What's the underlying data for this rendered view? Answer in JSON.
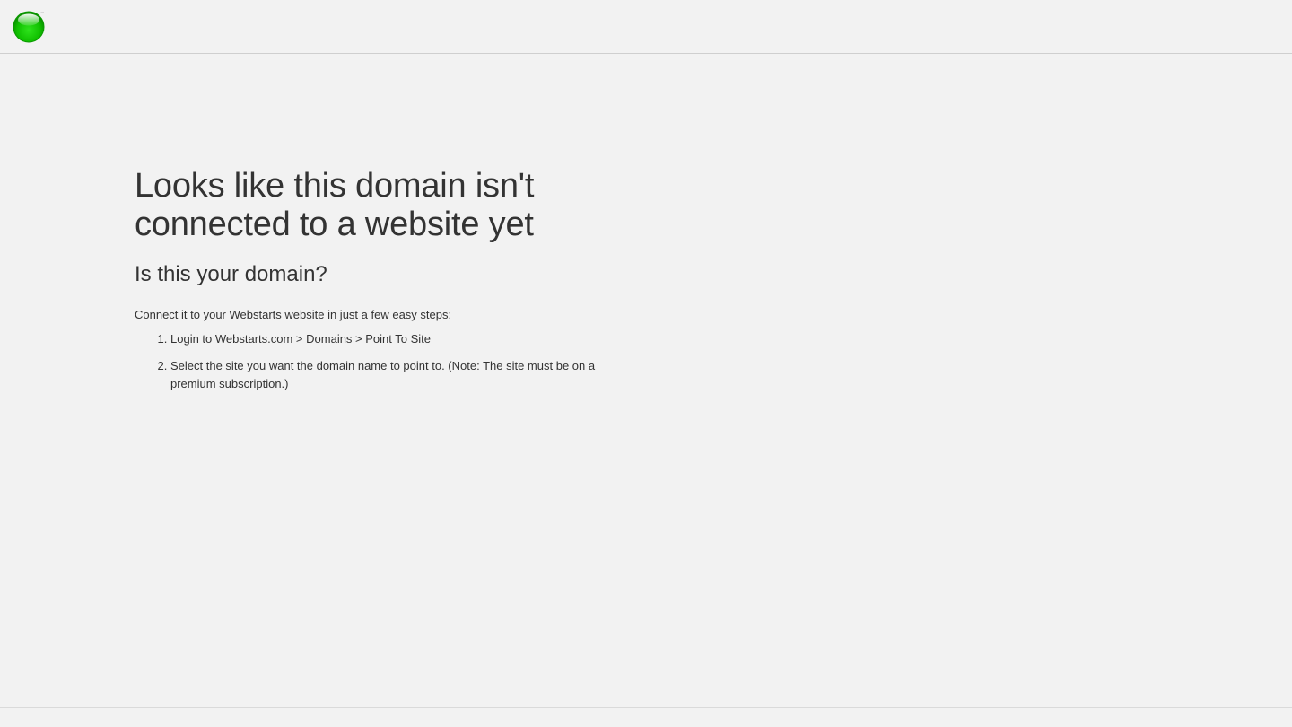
{
  "header": {
    "logo_icon": "green-globe-logo-icon",
    "logo_color": "#11c000"
  },
  "main": {
    "title": "Looks like this domain isn't connected to a website yet",
    "subtitle": "Is this your domain?",
    "intro": "Connect it to your Webstarts website in just a few easy steps:",
    "steps": [
      "Login to Webstarts.com > Domains > Point To Site",
      "Select the site you want the domain name to point to. (Note: The site must be on a premium subscription.)"
    ]
  },
  "colors": {
    "background": "#f2f2f2",
    "text": "#333333",
    "divider": "#cfcfcf"
  }
}
